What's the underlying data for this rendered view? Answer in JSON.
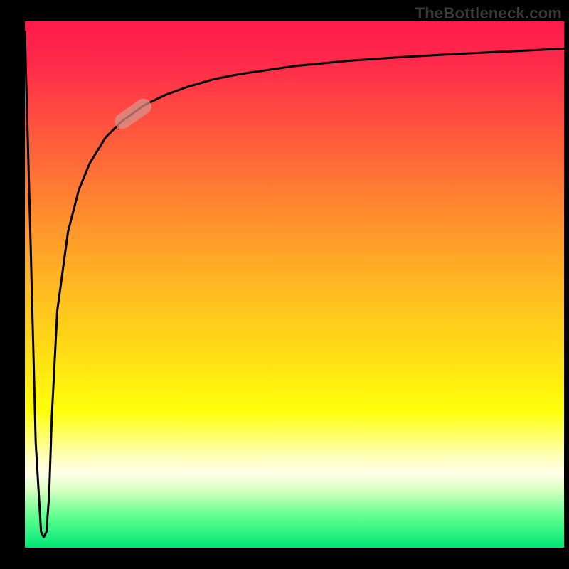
{
  "watermark": "TheBottleneck.com",
  "chart_data": {
    "type": "line",
    "title": "",
    "xlabel": "",
    "ylabel": "",
    "xlim": [
      0,
      100
    ],
    "ylim": [
      0,
      100
    ],
    "x": [
      0,
      1,
      2,
      3,
      3.5,
      4,
      4.5,
      5,
      6,
      8,
      10,
      12,
      15,
      18,
      22,
      26,
      30,
      35,
      40,
      50,
      60,
      70,
      80,
      90,
      100
    ],
    "values": [
      98,
      60,
      20,
      3,
      2,
      3,
      10,
      25,
      45,
      60,
      68,
      73,
      78,
      81,
      84,
      86,
      87.5,
      89,
      90,
      91.5,
      92.5,
      93.2,
      93.8,
      94.3,
      94.8
    ],
    "highlight_segment": {
      "x": 20,
      "y": 82.5,
      "angle_deg": -35
    },
    "gradient_stops": [
      {
        "pos": 0,
        "color": "#ff1a4d"
      },
      {
        "pos": 0.5,
        "color": "#ffe014"
      },
      {
        "pos": 0.86,
        "color": "#ffffe8"
      },
      {
        "pos": 1.0,
        "color": "#00e676"
      }
    ]
  }
}
